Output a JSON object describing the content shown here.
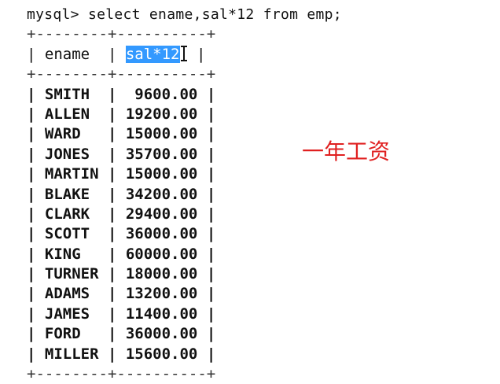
{
  "terminal": {
    "command": "mysql> select ename,sal*12 from emp;",
    "separator": "+--------+----------+",
    "header": {
      "col1": "ename",
      "col2": "sal*12"
    },
    "rows": [
      {
        "ename": "SMITH",
        "sal12": "9600.00"
      },
      {
        "ename": "ALLEN",
        "sal12": "19200.00"
      },
      {
        "ename": "WARD",
        "sal12": "15000.00"
      },
      {
        "ename": "JONES",
        "sal12": "35700.00"
      },
      {
        "ename": "MARTIN",
        "sal12": "15000.00"
      },
      {
        "ename": "BLAKE",
        "sal12": "34200.00"
      },
      {
        "ename": "CLARK",
        "sal12": "29400.00"
      },
      {
        "ename": "SCOTT",
        "sal12": "36000.00"
      },
      {
        "ename": "KING",
        "sal12": "60000.00"
      },
      {
        "ename": "TURNER",
        "sal12": "18000.00"
      },
      {
        "ename": "ADAMS",
        "sal12": "13200.00"
      },
      {
        "ename": "JAMES",
        "sal12": "11400.00"
      },
      {
        "ename": "FORD",
        "sal12": "36000.00"
      },
      {
        "ename": "MILLER",
        "sal12": "15600.00"
      }
    ]
  },
  "annotation": {
    "text": "一年工资",
    "color": "#e02020"
  },
  "colors": {
    "selection": "#3399ff",
    "text": "#111111"
  }
}
